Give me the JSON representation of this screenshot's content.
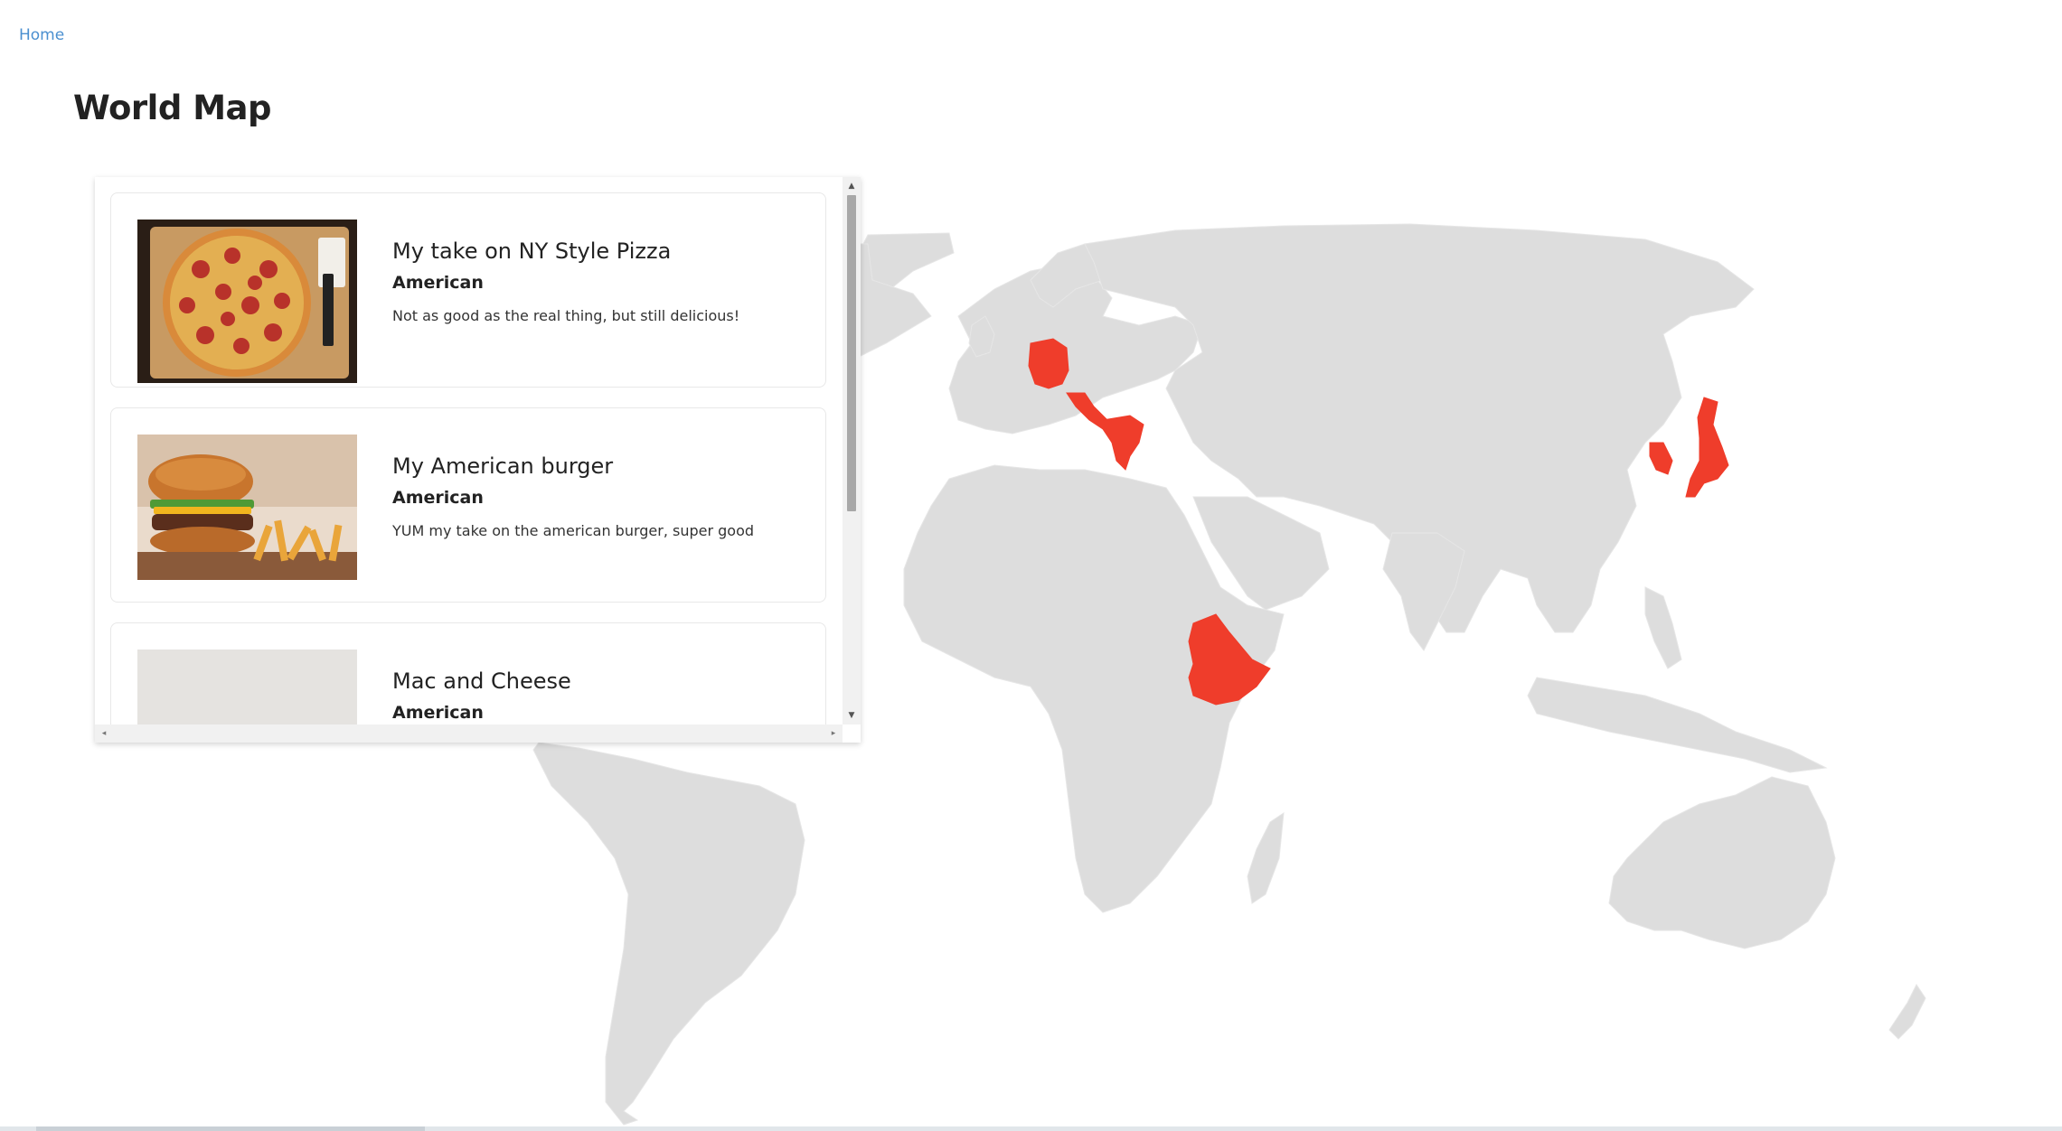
{
  "nav": {
    "home_label": "Home"
  },
  "page": {
    "title": "World Map"
  },
  "colors": {
    "land": "#dddddd",
    "highlight": "#ef3d2b",
    "link": "#4a8fd0"
  },
  "map": {
    "highlighted_countries": [
      "Germany",
      "Italy",
      "Greece",
      "Ethiopia",
      "South Korea",
      "Japan"
    ]
  },
  "recipes": [
    {
      "title": "My take on NY Style Pizza",
      "cuisine": "American",
      "description": "Not as good as the real thing, but still delicious!",
      "image": "pizza-photo"
    },
    {
      "title": "My American burger",
      "cuisine": "American",
      "description": "YUM my take on the american burger, super good",
      "image": "burger-photo"
    },
    {
      "title": "Mac and Cheese",
      "cuisine": "American",
      "description": "",
      "image": "mac-and-cheese-photo"
    }
  ]
}
